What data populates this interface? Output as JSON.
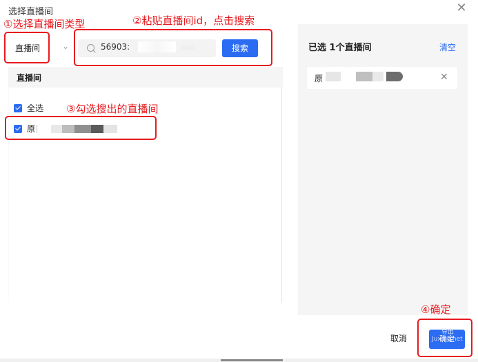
{
  "dialog": {
    "title": "选择直播间"
  },
  "toolbar": {
    "type_value": "直播间",
    "search_value": "56903:",
    "search_button": "搜索"
  },
  "list": {
    "header": "直播间",
    "select_all": "全选",
    "room_prefix": "原"
  },
  "selected": {
    "count_label": "已选 1个直播间",
    "clear": "清空",
    "item_prefix": "原"
  },
  "footer": {
    "cancel": "取消",
    "ok": "确定",
    "watermark_top": "导出",
    "watermark": "Juxiao.net"
  },
  "annotations": {
    "step1": "①选择直播间类型",
    "step2": "②粘贴直播间id，点击搜索",
    "step3": "③勾选搜出的直播间",
    "step4": "④确定"
  },
  "colors": {
    "accent": "#2b6cf2",
    "annotation": "#e8191e",
    "panel_bg": "#f5f5f5"
  },
  "icons": [
    "close-icon",
    "chevron-down-icon",
    "search-icon",
    "checkbox-checked-icon",
    "remove-icon"
  ]
}
